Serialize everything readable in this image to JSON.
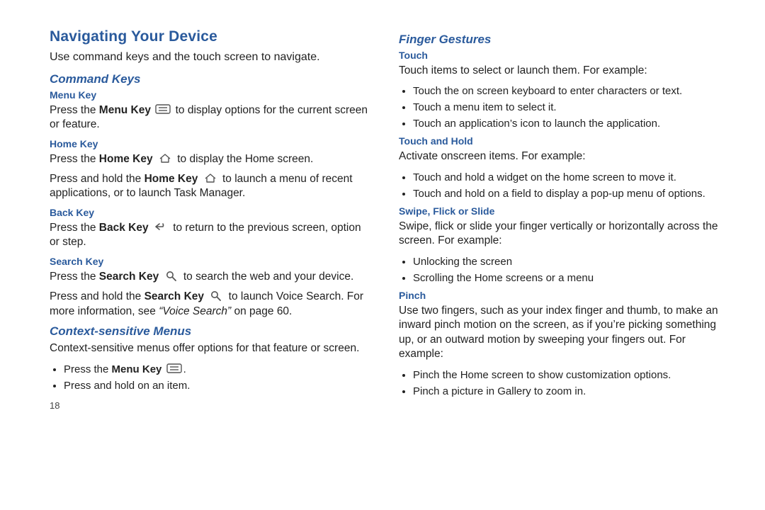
{
  "page_number": "18",
  "left": {
    "title": "Navigating Your Device",
    "intro": "Use command keys and the touch screen to navigate.",
    "command_keys_heading": "Command Keys",
    "menu_key": {
      "heading": "Menu Key",
      "p1a": "Press the ",
      "p1b": "Menu Key",
      "p1c": " to display options for the current screen or feature."
    },
    "home_key": {
      "heading": "Home Key",
      "p1a": "Press the ",
      "p1b": "Home Key",
      "p1c": " to display the Home screen.",
      "p2a": "Press and hold the ",
      "p2b": "Home Key",
      "p2c": " to launch a menu of recent applications, or to launch Task Manager."
    },
    "back_key": {
      "heading": "Back Key",
      "p1a": "Press the ",
      "p1b": "Back Key",
      "p1c": " to return to the previous screen, option or step."
    },
    "search_key": {
      "heading": "Search Key",
      "p1a": "Press the ",
      "p1b": "Search Key",
      "p1c": " to search the web and your device.",
      "p2a": "Press and hold the ",
      "p2b": "Search Key",
      "p2c": " to launch Voice Search. For more information, see ",
      "p2d": "“Voice Search”",
      "p2e": " on page 60."
    },
    "context_heading": "Context-sensitive Menus",
    "context_p": "Context-sensitive menus offer options for that feature or screen.",
    "context_b1a": "Press the ",
    "context_b1b": "Menu Key",
    "context_b1c": ".",
    "context_b2": "Press and hold on an item."
  },
  "right": {
    "finger_heading": "Finger Gestures",
    "touch": {
      "heading": "Touch",
      "p": "Touch items to select or launch them. For example:",
      "b1": "Touch the on screen keyboard to enter characters or text.",
      "b2": "Touch a menu item to select it.",
      "b3": "Touch an application’s icon to launch the application."
    },
    "touch_hold": {
      "heading": "Touch and Hold",
      "p": "Activate onscreen items. For example:",
      "b1": "Touch and hold a widget on the home screen to move it.",
      "b2": "Touch and hold on a field to display a pop-up menu of options."
    },
    "swipe": {
      "heading": "Swipe, Flick or Slide",
      "p": "Swipe, flick or slide your finger vertically or horizontally across the screen. For example:",
      "b1": "Unlocking the screen",
      "b2": "Scrolling the Home screens or a menu"
    },
    "pinch": {
      "heading": "Pinch",
      "p": "Use two fingers, such as your index finger and thumb, to make an inward pinch motion on the screen, as if you’re picking something up, or an outward motion by sweeping your fingers out. For example:",
      "b1": "Pinch the Home screen to show customization options.",
      "b2": "Pinch a picture in Gallery to zoom in."
    }
  }
}
